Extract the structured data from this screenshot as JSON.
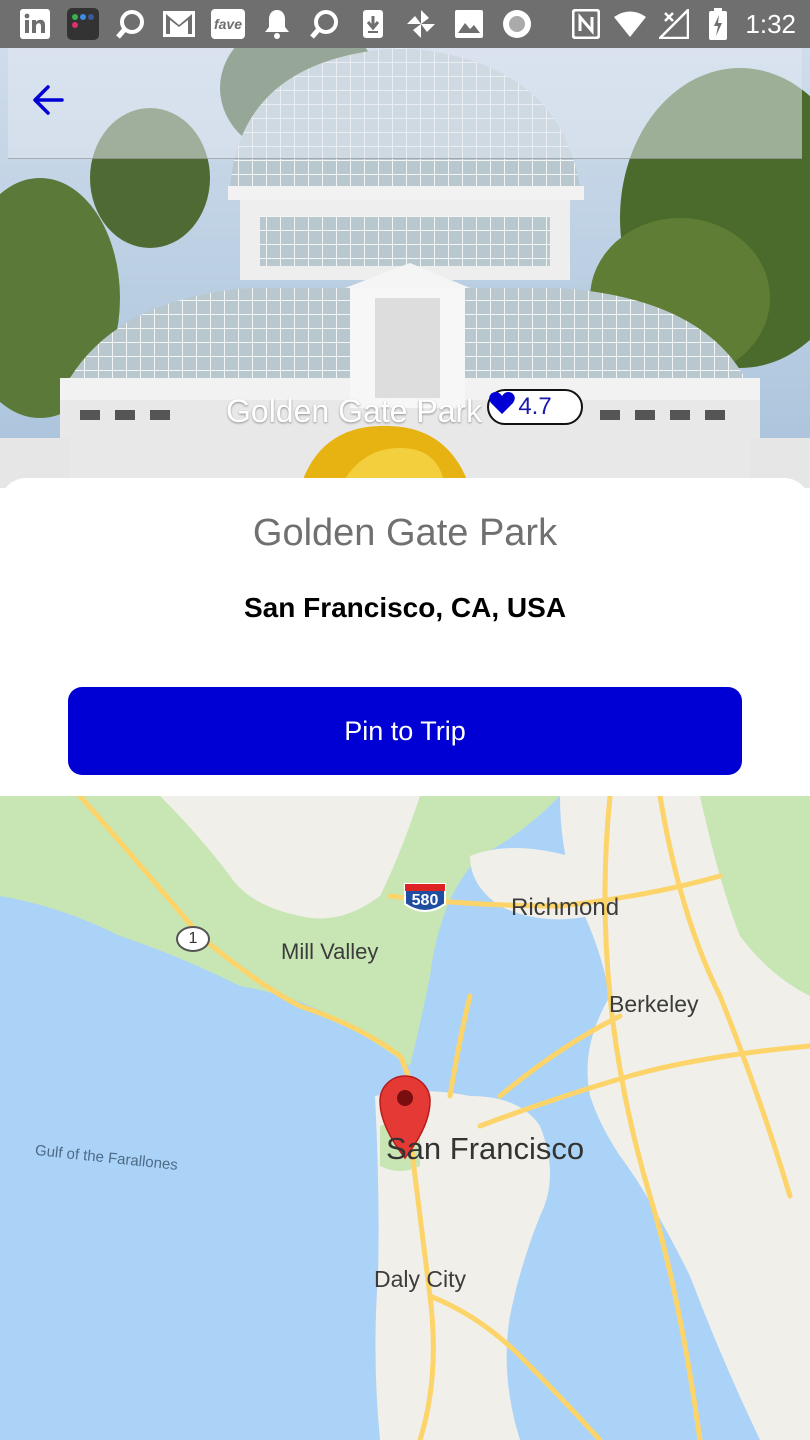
{
  "status_bar": {
    "time": "1:32",
    "icons": [
      "linkedin-icon",
      "app-folder-icon",
      "search-icon",
      "gmail-icon",
      "fave-icon",
      "bell-icon",
      "search-icon",
      "download-icon",
      "pinwheel-icon",
      "image-icon",
      "record-icon",
      "nfc-icon",
      "wifi-icon",
      "signal-icon",
      "battery-icon"
    ],
    "fave_label": "fave"
  },
  "hero": {
    "place_name": "Golden Gate Park",
    "rating": "4.7"
  },
  "card": {
    "title": "Golden Gate Park",
    "location": "San Francisco, CA, USA",
    "pin_button_label": "Pin to Trip"
  },
  "map": {
    "labels": {
      "richmond": "Richmond",
      "mill_valley": "Mill Valley",
      "berkeley": "Berkeley",
      "san_francisco": "San Francisco",
      "daly_city": "Daly City",
      "gulf": "Gulf of the Farallones"
    },
    "shields": {
      "interstate": "580",
      "highway": "1"
    }
  },
  "colors": {
    "accent": "#0000d4",
    "status_bar": "#6f6f6f",
    "water": "#aad3f7",
    "land": "#f1f1f1",
    "park": "#c5e6b0",
    "road": "#ffd35f",
    "marker": "#e53935"
  }
}
